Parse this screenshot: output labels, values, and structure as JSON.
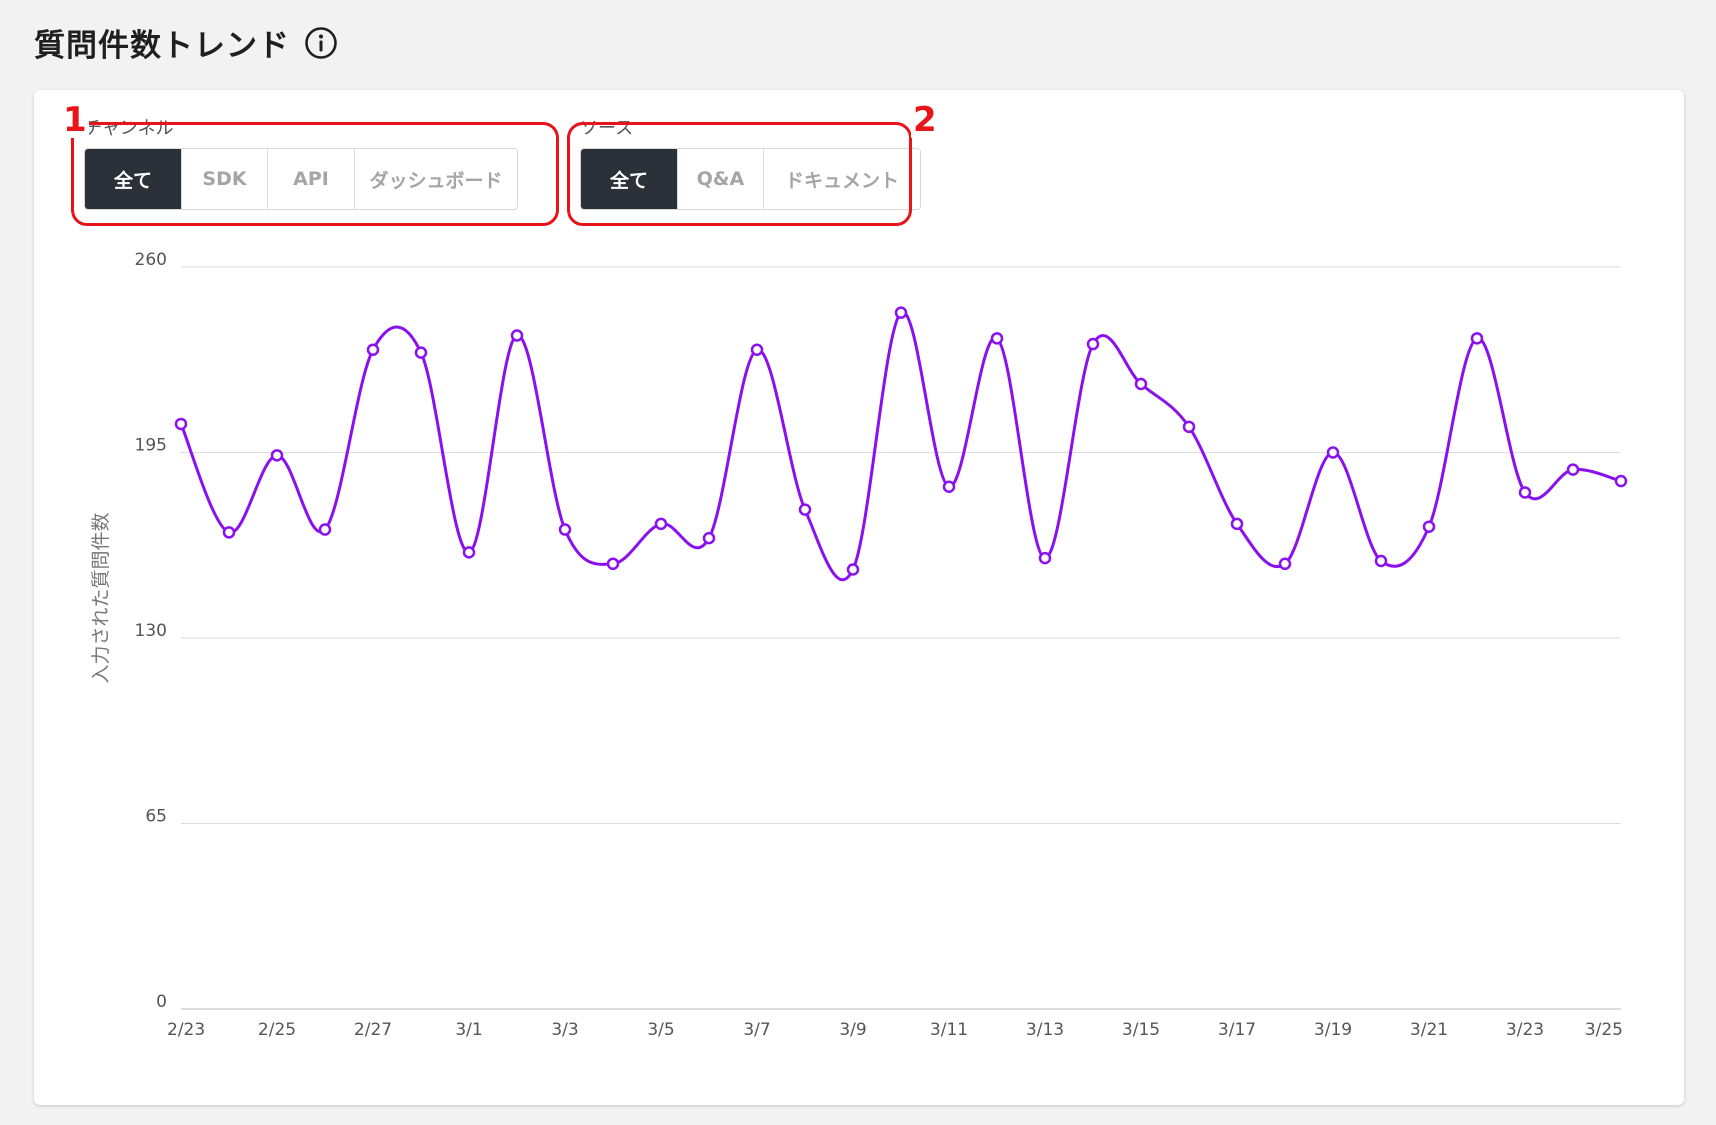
{
  "page": {
    "title": "質問件数トレンド",
    "info_icon": "info-circle-icon"
  },
  "filters": {
    "channel": {
      "label": "チャンネル",
      "options": [
        "全て",
        "SDK",
        "API",
        "ダッシュボード"
      ],
      "selected": "全て",
      "callout_number": "1"
    },
    "source": {
      "label": "ソース",
      "options": [
        "全て",
        "Q&A",
        "ドキュメント"
      ],
      "selected": "全て",
      "callout_number": "2"
    }
  },
  "colors": {
    "line": "#8a10f0",
    "active_button": "#2b3139",
    "callout": "#e8141a",
    "grid": "#dddddd"
  },
  "chart_data": {
    "type": "line",
    "smooth": true,
    "x": [
      "2/23",
      "2/24",
      "2/25",
      "2/26",
      "2/27",
      "2/28",
      "3/1",
      "3/2",
      "3/3",
      "3/4",
      "3/5",
      "3/6",
      "3/7",
      "3/8",
      "3/9",
      "3/10",
      "3/11",
      "3/12",
      "3/13",
      "3/14",
      "3/15",
      "3/16",
      "3/17",
      "3/18",
      "3/19",
      "3/20",
      "3/21",
      "3/22",
      "3/23",
      "3/24",
      "3/25"
    ],
    "x_tick_labels": [
      "2/23",
      "2/25",
      "2/27",
      "3/1",
      "3/3",
      "3/5",
      "3/7",
      "3/9",
      "3/11",
      "3/13",
      "3/15",
      "3/17",
      "3/19",
      "3/21",
      "3/23",
      "3/25"
    ],
    "series": [
      {
        "values": [
          205,
          167,
          194,
          168,
          231,
          230,
          160,
          236,
          168,
          156,
          170,
          165,
          231,
          175,
          154,
          244,
          183,
          235,
          158,
          233,
          219,
          204,
          170,
          156,
          195,
          157,
          169,
          235,
          181,
          189,
          185
        ]
      }
    ],
    "yticks": [
      0,
      65,
      130,
      195,
      260
    ],
    "ylim": [
      0,
      260
    ],
    "ylabel": "入力された質問件数",
    "xlabel": "",
    "grid": "horizontal"
  }
}
